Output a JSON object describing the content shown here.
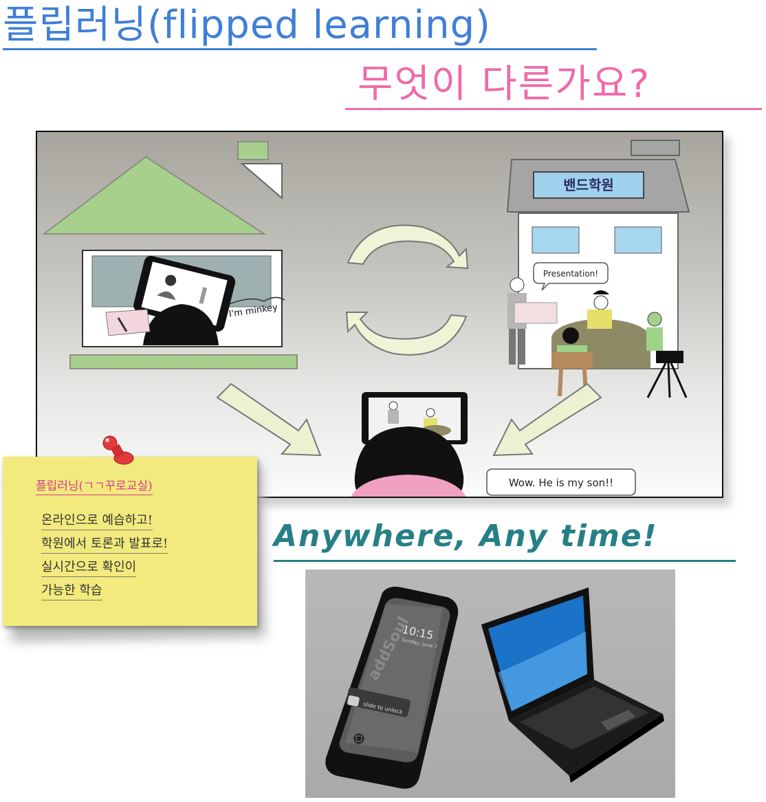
{
  "title": {
    "main": "플립러닝(flipped learning)",
    "question": "무엇이 다른가요?"
  },
  "diagram": {
    "academy_sign": "밴드학원",
    "presentation_bubble": "Presentation!",
    "tablet_caption": "I'm minkey",
    "parent_bubble": "Wow. He is my son!!"
  },
  "note": {
    "title": "플립러닝(ㄱㄱ꾸로교실)",
    "lines": [
      "온라인으로 예습하고!",
      "학원에서 토론과 발표로!",
      "실시간으로 확인이",
      "가능한 학습"
    ]
  },
  "tagline": "Anywhere, Any time!",
  "phone": {
    "time": "10:15",
    "date": "Sunday, June 7",
    "brand": "addSoul",
    "slide_label": "slide to unlock"
  },
  "colors": {
    "title_blue": "#3f7fd6",
    "title_pink": "#f06aa8",
    "tagline_teal": "#277f86",
    "note_yellow": "#f2ea7e",
    "house_green": "#a7d08c"
  }
}
